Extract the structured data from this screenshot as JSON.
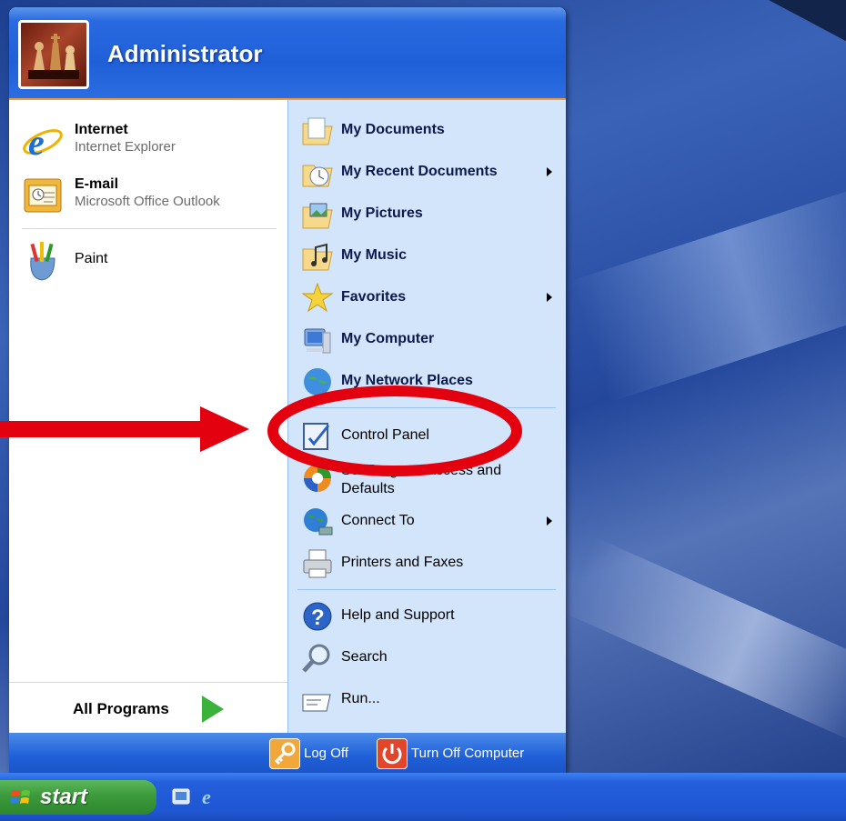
{
  "user": {
    "name": "Administrator"
  },
  "pinned": [
    {
      "title": "Internet",
      "subtitle": "Internet Explorer",
      "icon": "internet-explorer-icon"
    },
    {
      "title": "E-mail",
      "subtitle": "Microsoft Office Outlook",
      "icon": "outlook-icon"
    }
  ],
  "recent": [
    {
      "label": "Paint",
      "icon": "paint-icon"
    }
  ],
  "all_programs": {
    "label": "All Programs"
  },
  "places": [
    {
      "label": "My Documents",
      "icon": "my-documents-icon",
      "bold": true,
      "submenu": false
    },
    {
      "label": "My Recent Documents",
      "icon": "my-recent-documents-icon",
      "bold": true,
      "submenu": true
    },
    {
      "label": "My Pictures",
      "icon": "my-pictures-icon",
      "bold": true,
      "submenu": false
    },
    {
      "label": "My Music",
      "icon": "my-music-icon",
      "bold": true,
      "submenu": false
    },
    {
      "label": "Favorites",
      "icon": "favorites-star-icon",
      "bold": true,
      "submenu": true
    },
    {
      "label": "My Computer",
      "icon": "my-computer-icon",
      "bold": true,
      "submenu": false
    },
    {
      "label": "My Network Places",
      "icon": "my-network-places-icon",
      "bold": true,
      "submenu": false
    }
  ],
  "settings": [
    {
      "label": "Control Panel",
      "icon": "control-panel-icon",
      "submenu": false
    },
    {
      "label": "Set Program Access and Defaults",
      "icon": "program-access-icon",
      "submenu": false
    },
    {
      "label": "Connect To",
      "icon": "connect-to-icon",
      "submenu": true
    },
    {
      "label": "Printers and Faxes",
      "icon": "printer-icon",
      "submenu": false
    }
  ],
  "tools": [
    {
      "label": "Help and Support",
      "icon": "help-icon"
    },
    {
      "label": "Search",
      "icon": "search-icon"
    },
    {
      "label": "Run...",
      "icon": "run-icon"
    }
  ],
  "footer": {
    "log_off": "Log Off",
    "turn_off": "Turn Off Computer"
  },
  "taskbar": {
    "start_label": "start"
  },
  "colors": {
    "header_blue": "#1f5fd8",
    "pane_blue": "#d3e5fa",
    "start_green": "#3b9a3b",
    "annotation_red": "#e3000f"
  }
}
